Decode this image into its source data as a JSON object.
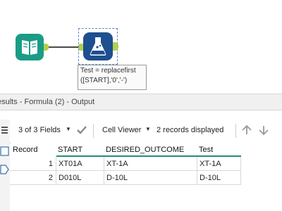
{
  "canvas": {
    "annotation_lines": [
      "Test = replacefirst",
      "([START],'0','-')"
    ],
    "input_tool_icon": "book-icon",
    "formula_tool_icon": "flask-icon"
  },
  "panel": {
    "title": "esults - Formula (2) - Output"
  },
  "toolbar": {
    "fields_label": "3 of 3 Fields",
    "viewer_label": "Cell Viewer",
    "records_label": "2 records displayed"
  },
  "grid": {
    "columns": [
      "Record",
      "START",
      "DESIRED_OUTCOME",
      "Test"
    ],
    "rows": [
      {
        "record": "1",
        "start": "XT01A",
        "desired": "XT-1A",
        "test": "XT-1A"
      },
      {
        "record": "2",
        "start": "D010L",
        "desired": "D-10L",
        "test": "D-10L"
      }
    ]
  },
  "colors": {
    "input_tool": "#1a9c86",
    "formula_tool": "#1e4f8f",
    "anchor": "#b3cf4a",
    "column_underline": "#1e8f7a"
  }
}
